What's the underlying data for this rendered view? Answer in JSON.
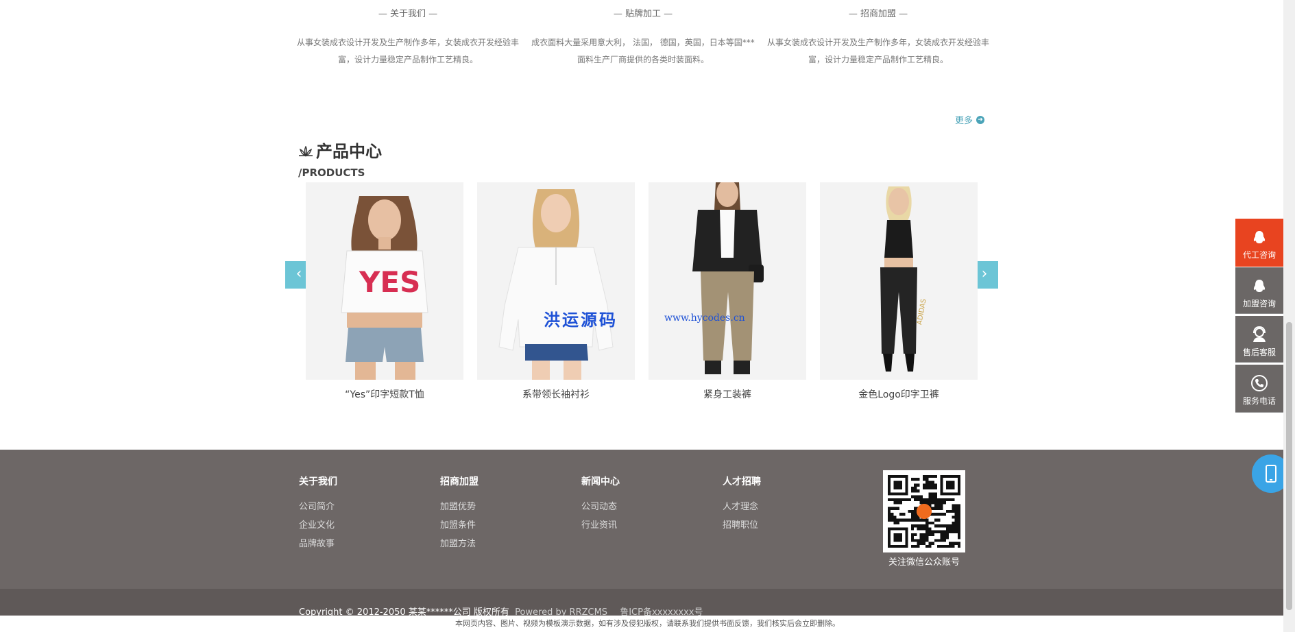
{
  "intro": [
    {
      "title": "— 关于我们 —",
      "text": "从事女装成衣设计开发及生产制作多年，女装成衣开发经验丰富，设计力量稳定产品制作工艺精良。"
    },
    {
      "title": "— 贴牌加工 —",
      "text": "成衣面料大量采用意大利， 法国， 德国，英国，日本等国***面料生产厂商提供的各类时装面料。"
    },
    {
      "title": "— 招商加盟 —",
      "text": "从事女装成衣设计开发及生产制作多年，女装成衣开发经验丰富，设计力量稳定产品制作工艺精良。"
    }
  ],
  "more_label": "更多",
  "products": {
    "title": "产品中心",
    "subtitle": "/PRODUCTS",
    "items": [
      {
        "name": "“Yes”印字短款T恤"
      },
      {
        "name": "系带领长袖衬衫"
      },
      {
        "name": "紧身工装裤"
      },
      {
        "name": "金色Logo印字卫裤"
      }
    ]
  },
  "watermark": {
    "cn": "洪运源码",
    "url": "www.hycodes.cn"
  },
  "footer": {
    "columns": [
      {
        "heading": "关于我们",
        "items": [
          "公司简介",
          "企业文化",
          "品牌故事"
        ]
      },
      {
        "heading": "招商加盟",
        "items": [
          "加盟优势",
          "加盟条件",
          "加盟方法"
        ]
      },
      {
        "heading": "新闻中心",
        "items": [
          "公司动态",
          "行业资讯"
        ]
      },
      {
        "heading": "人才招聘",
        "items": [
          "人才理念",
          "招聘职位"
        ]
      }
    ],
    "qr_label": "关注微信公众账号",
    "copyright": "Copyright © 2012-2050 某某******公司 版权所有",
    "powered": "Powered by RRZCMS",
    "icp": "鲁ICP备xxxxxxxx号",
    "disclaimer": "本网页内容、图片、视频为模板演示数据，如有涉及侵犯版权，请联系我们提供书面反馈，我们核实后会立即删除。"
  },
  "side_panel": [
    {
      "label": "代工咨询",
      "icon": "qq-icon"
    },
    {
      "label": "加盟咨询",
      "icon": "qq-icon"
    },
    {
      "label": "售后客服",
      "icon": "headset-icon"
    },
    {
      "label": "服务电话",
      "icon": "phone-icon"
    }
  ],
  "colors": {
    "accent": "#6cc5d6",
    "side_active": "#e84420",
    "footer_bg": "#6d6766",
    "phone_btn": "#3aa4e6"
  }
}
